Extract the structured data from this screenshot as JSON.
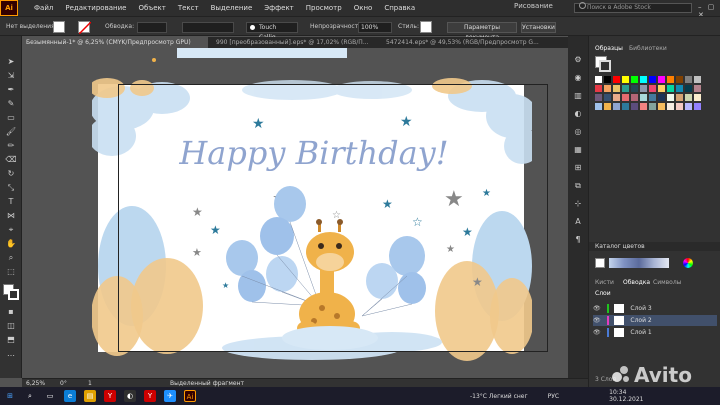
{
  "app": {
    "logo": "Ai"
  },
  "menu": [
    "Файл",
    "Редактирование",
    "Объект",
    "Текст",
    "Выделение",
    "Эффект",
    "Просмотр",
    "Окно",
    "Справка"
  ],
  "workspace": "Рисование",
  "search_placeholder": "Поиск в Adobe Stock",
  "control": {
    "selection": "Нет выделения",
    "stroke_label": "Обводка:",
    "brush": "Touch Callig...",
    "opacity_label": "Непрозрачность:",
    "opacity_value": "100%",
    "style_label": "Стиль:",
    "doc_settings": "Параметры документа",
    "settings": "Установки"
  },
  "tabs": [
    "Безымянный-1* @ 6,25% (CMYK/Предпросмотр GPU)",
    "990 [преобразованный].eps* @ 17,02% (RGB/П...",
    "5472414.eps* @ 49,53% (RGB/Предпросмотр G..."
  ],
  "artwork": {
    "title": "Happy Birthday!"
  },
  "status": {
    "zoom": "6,25%",
    "angle": "0°",
    "artboard": "1",
    "tool": "Выделенный фрагмент"
  },
  "panels": {
    "swatches_tab": "Образцы",
    "libraries_tab": "Библиотеки",
    "color_catalog": "Каталог цветов",
    "brushes_tab": "Кисти",
    "stroke_tab": "Обводка",
    "symbols_tab": "Символы",
    "layers_title": "Слои",
    "layers": [
      "Слой 3",
      "Слой 2",
      "Слой 1"
    ],
    "layers_count": "3 Слоя"
  },
  "taskbar": {
    "weather": "-13°C  Легкий снег",
    "lang": "РУС",
    "time": "10:34",
    "date": "30.12.2021"
  },
  "watermark": "Avito",
  "colors": {
    "accent_blue": "#4a80c0",
    "title": "#8fa4cf",
    "balloon": "#a8c8ec",
    "cloud": "#cfe3f4",
    "tree": "#f1c98b",
    "giraffe": "#f0b24a"
  }
}
